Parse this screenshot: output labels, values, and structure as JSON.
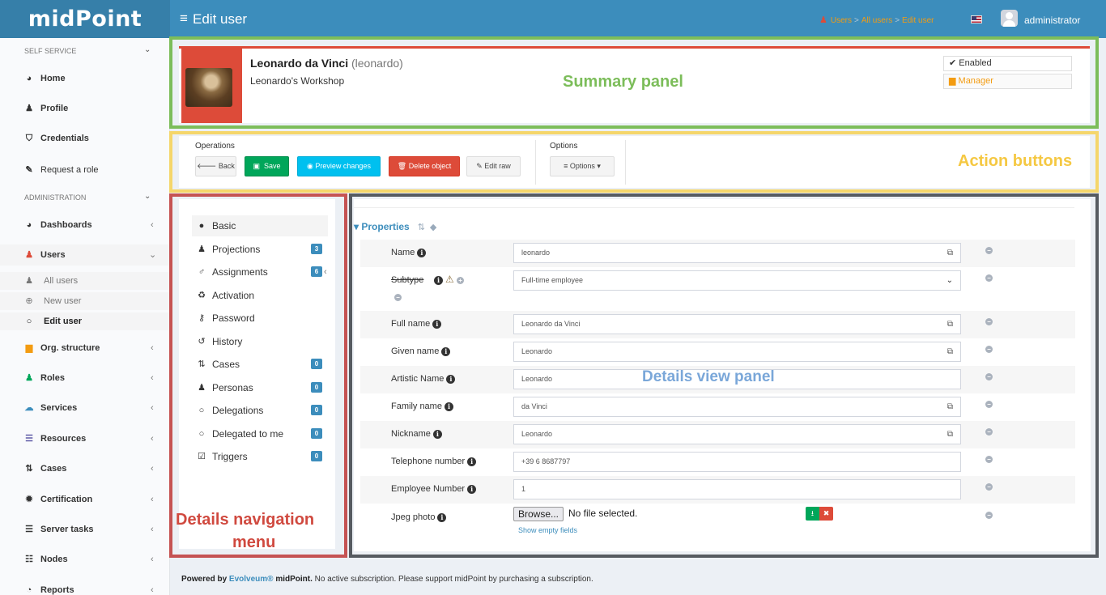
{
  "app": {
    "logo": "midPoint",
    "page_title": "Edit user",
    "breadcrumbs": [
      "Users",
      "All users",
      "Edit user"
    ],
    "user": "administrator"
  },
  "sidebar": {
    "self_service_label": "SELF SERVICE",
    "self_service": [
      {
        "label": "Home",
        "icon": "dashboard-icon"
      },
      {
        "label": "Profile",
        "icon": "user-icon"
      },
      {
        "label": "Credentials",
        "icon": "shield-icon"
      },
      {
        "label": "Request a role",
        "icon": "edit-icon"
      }
    ],
    "administration_label": "ADMINISTRATION",
    "administration": [
      {
        "label": "Dashboards",
        "icon": "dashboard-icon"
      },
      {
        "label": "Users",
        "icon": "user-icon",
        "color": "#dd4b39"
      },
      {
        "label": "Org. structure",
        "icon": "building-icon",
        "color": "#f39c12"
      },
      {
        "label": "Roles",
        "icon": "roles-icon",
        "color": "#00a65a"
      },
      {
        "label": "Services",
        "icon": "cloud-icon",
        "color": "#3c8dbc"
      },
      {
        "label": "Resources",
        "icon": "database-icon",
        "color": "#605ca8"
      },
      {
        "label": "Cases",
        "icon": "cases-icon"
      },
      {
        "label": "Certification",
        "icon": "certificate-icon"
      },
      {
        "label": "Server tasks",
        "icon": "tasks-icon"
      },
      {
        "label": "Nodes",
        "icon": "nodes-icon"
      },
      {
        "label": "Reports",
        "icon": "reports-icon"
      }
    ],
    "users_sub": [
      {
        "label": "All users"
      },
      {
        "label": "New user"
      },
      {
        "label": "Edit user"
      }
    ]
  },
  "summary": {
    "name": "Leonardo da Vinci",
    "login": "(leonardo)",
    "org": "Leonardo's Workshop",
    "tag_enabled": "Enabled",
    "tag_manager": "Manager"
  },
  "actions": {
    "operations_label": "Operations",
    "back": "Back",
    "save": "Save",
    "preview": "Preview changes",
    "delete": "Delete object",
    "edit_raw": "Edit raw",
    "options_label": "Options",
    "options": "Options"
  },
  "nav": [
    {
      "label": "Basic",
      "badge": ""
    },
    {
      "label": "Projections",
      "badge": "3"
    },
    {
      "label": "Assignments",
      "badge": "6"
    },
    {
      "label": "Activation",
      "badge": ""
    },
    {
      "label": "Password",
      "badge": ""
    },
    {
      "label": "History",
      "badge": ""
    },
    {
      "label": "Cases",
      "badge": "0"
    },
    {
      "label": "Personas",
      "badge": "0"
    },
    {
      "label": "Delegations",
      "badge": "0"
    },
    {
      "label": "Delegated to me",
      "badge": "0"
    },
    {
      "label": "Triggers",
      "badge": "0"
    }
  ],
  "details": {
    "section_title": "Properties",
    "fields": [
      {
        "label": "Name",
        "value": "leonardo"
      },
      {
        "label": "Subtype",
        "value": "Full-time employee"
      },
      {
        "label": "Full name",
        "value": "Leonardo da Vinci"
      },
      {
        "label": "Given name",
        "value": "Leonardo"
      },
      {
        "label": "Artistic Name",
        "value": "Leonardo"
      },
      {
        "label": "Family name",
        "value": "da Vinci"
      },
      {
        "label": "Nickname",
        "value": "Leonardo"
      },
      {
        "label": "Telephone number",
        "value": "+39 6 8687797"
      },
      {
        "label": "Employee Number",
        "value": "1"
      },
      {
        "label": "Jpeg photo",
        "value": ""
      }
    ],
    "browse": "Browse...",
    "file_status": "No file selected.",
    "show_empty": "Show empty fields"
  },
  "footer": {
    "powered": "Powered by",
    "brand": "Evolveum®",
    "product": "midPoint.",
    "notice": "No active subscription. Please support midPoint by purchasing a subscription."
  },
  "annotations": {
    "summary": "Summary panel",
    "actions": "Action buttons",
    "nav_line1": "Details  navigation",
    "nav_line2": "menu",
    "details": "Details view panel",
    "colors": {
      "summary": "#7cbd5a",
      "actions": "#f5d66b",
      "nav": "#c55353",
      "details": "#565b61"
    }
  }
}
